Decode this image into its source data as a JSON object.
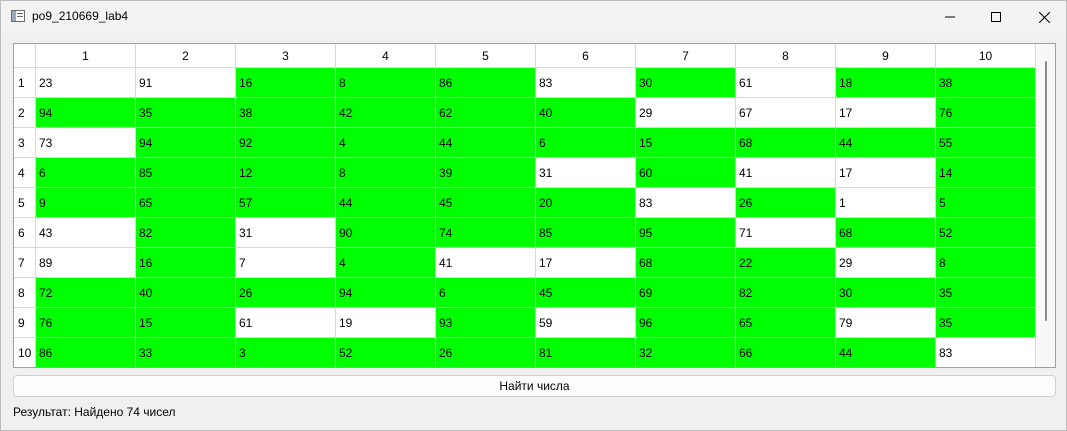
{
  "window": {
    "title": "po9_210669_lab4",
    "icon": "app-window-icon"
  },
  "table": {
    "columns": [
      "1",
      "2",
      "3",
      "4",
      "5",
      "6",
      "7",
      "8",
      "9",
      "10"
    ],
    "rows": [
      "1",
      "2",
      "3",
      "4",
      "5",
      "6",
      "7",
      "8",
      "9",
      "10"
    ],
    "values": [
      [
        23,
        91,
        16,
        8,
        86,
        83,
        30,
        61,
        18,
        38
      ],
      [
        94,
        35,
        38,
        42,
        62,
        40,
        29,
        67,
        17,
        76
      ],
      [
        73,
        94,
        92,
        4,
        44,
        6,
        15,
        68,
        44,
        55
      ],
      [
        6,
        85,
        12,
        8,
        39,
        31,
        60,
        41,
        17,
        14
      ],
      [
        9,
        65,
        57,
        44,
        45,
        20,
        83,
        26,
        1,
        5
      ],
      [
        43,
        82,
        31,
        90,
        74,
        85,
        95,
        71,
        68,
        52
      ],
      [
        89,
        16,
        7,
        4,
        41,
        17,
        68,
        22,
        29,
        8
      ],
      [
        72,
        40,
        26,
        94,
        6,
        45,
        69,
        82,
        30,
        35
      ],
      [
        76,
        15,
        61,
        19,
        93,
        59,
        96,
        65,
        79,
        35
      ],
      [
        86,
        33,
        3,
        52,
        26,
        81,
        32,
        66,
        44,
        83
      ]
    ],
    "highlighted": [
      [
        false,
        false,
        true,
        true,
        true,
        false,
        true,
        false,
        true,
        true
      ],
      [
        true,
        true,
        true,
        true,
        true,
        true,
        false,
        false,
        false,
        true
      ],
      [
        false,
        true,
        true,
        true,
        true,
        true,
        true,
        true,
        true,
        true
      ],
      [
        true,
        true,
        true,
        true,
        true,
        false,
        true,
        false,
        false,
        true
      ],
      [
        true,
        true,
        true,
        true,
        true,
        true,
        false,
        true,
        false,
        true
      ],
      [
        false,
        true,
        false,
        true,
        true,
        true,
        true,
        false,
        true,
        true
      ],
      [
        false,
        true,
        false,
        true,
        false,
        false,
        true,
        true,
        false,
        true
      ],
      [
        true,
        true,
        true,
        true,
        true,
        true,
        true,
        true,
        true,
        true
      ],
      [
        true,
        true,
        false,
        false,
        true,
        false,
        true,
        true,
        false,
        true
      ],
      [
        true,
        true,
        true,
        true,
        true,
        true,
        true,
        true,
        true,
        false
      ]
    ],
    "highlight_color": "#00ff00",
    "normal_color": "#ffffff"
  },
  "actions": {
    "find_label": "Найти числа"
  },
  "status": {
    "result_text": "Результат: Найдено 74 чисел"
  }
}
